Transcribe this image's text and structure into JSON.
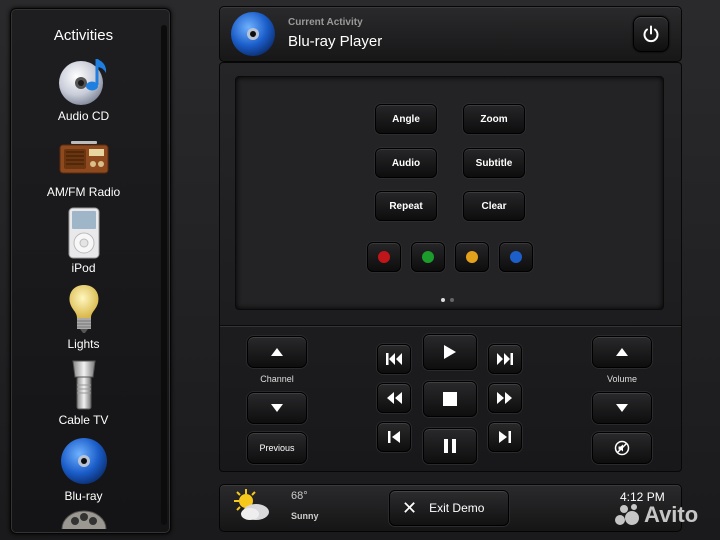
{
  "sidebar": {
    "title": "Activities",
    "items": [
      {
        "label": "Audio CD",
        "icon": "audio-cd-icon"
      },
      {
        "label": "AM/FM Radio",
        "icon": "radio-icon"
      },
      {
        "label": "iPod",
        "icon": "ipod-icon"
      },
      {
        "label": "Lights",
        "icon": "lightbulb-icon"
      },
      {
        "label": "Cable TV",
        "icon": "flashlight-icon"
      },
      {
        "label": "Blu-ray",
        "icon": "bluray-disc-icon"
      }
    ]
  },
  "header": {
    "subtitle": "Current Activity",
    "title": "Blu-ray Player"
  },
  "pad": {
    "buttons": [
      "Angle",
      "Zoom",
      "Audio",
      "Subtitle",
      "Repeat",
      "Clear"
    ],
    "color_buttons": [
      "#c0161a",
      "#1c9c2a",
      "#e4a21c",
      "#1d5fc9"
    ]
  },
  "channel": {
    "label": "Channel",
    "previous": "Previous"
  },
  "volume": {
    "label": "Volume"
  },
  "footer": {
    "temperature": "68°",
    "condition": "Sunny",
    "exit_label": "Exit Demo",
    "time": "4:12 PM"
  },
  "watermark": {
    "text": "Avito"
  }
}
